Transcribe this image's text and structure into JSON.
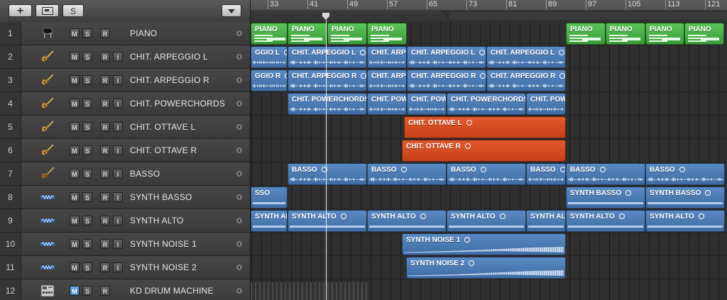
{
  "toolbar": {
    "add_label": "+",
    "solo_label": "S"
  },
  "ruler": {
    "bars": [
      "33",
      "41",
      "49",
      "57",
      "65",
      "73",
      "81",
      "89",
      "97",
      "105",
      "113",
      "121"
    ]
  },
  "tracks": [
    {
      "num": "1",
      "name": "PIANO",
      "icon": "grand-piano-icon",
      "msri": [
        "M",
        "S",
        "R"
      ]
    },
    {
      "num": "2",
      "name": "CHIT. ARPEGGIO L",
      "icon": "electric-guitar-icon",
      "msri": [
        "M",
        "S",
        "R",
        "I"
      ]
    },
    {
      "num": "3",
      "name": "CHIT. ARPEGGIO R",
      "icon": "electric-guitar-icon",
      "msri": [
        "M",
        "S",
        "R",
        "I"
      ]
    },
    {
      "num": "4",
      "name": "CHIT. POWERCHORDS",
      "icon": "electric-guitar-icon",
      "msri": [
        "M",
        "S",
        "R",
        "I"
      ]
    },
    {
      "num": "5",
      "name": "CHIT. OTTAVE L",
      "icon": "electric-guitar-icon",
      "msri": [
        "M",
        "S",
        "R",
        "I"
      ]
    },
    {
      "num": "6",
      "name": "CHIT. OTTAVE R",
      "icon": "electric-guitar-icon",
      "msri": [
        "M",
        "S",
        "R",
        "I"
      ]
    },
    {
      "num": "7",
      "name": "BASSO",
      "icon": "bass-guitar-icon",
      "msri": [
        "M",
        "S",
        "R",
        "I"
      ]
    },
    {
      "num": "8",
      "name": "SYNTH BASSO",
      "icon": "waveform-icon",
      "msri": [
        "M",
        "S",
        "R",
        "I"
      ]
    },
    {
      "num": "9",
      "name": "SYNTH ALTO",
      "icon": "waveform-icon",
      "msri": [
        "M",
        "S",
        "R",
        "I"
      ]
    },
    {
      "num": "10",
      "name": "SYNTH NOISE 1",
      "icon": "waveform-icon",
      "msri": [
        "M",
        "S",
        "R",
        "I"
      ]
    },
    {
      "num": "11",
      "name": "SYNTH NOISE 2",
      "icon": "waveform-icon",
      "msri": [
        "M",
        "S",
        "R",
        "I"
      ]
    },
    {
      "num": "12",
      "name": "KD DRUM MACHINE",
      "icon": "drum-machine-icon",
      "msri": [
        "M",
        "S",
        "R"
      ]
    }
  ],
  "regions": [
    {
      "track": 1,
      "start": 0,
      "end": 52,
      "label": "PIANO",
      "kind": "green"
    },
    {
      "track": 1,
      "start": 52,
      "end": 108,
      "label": "PIANO",
      "kind": "green"
    },
    {
      "track": 1,
      "start": 108,
      "end": 164,
      "label": "PIANO",
      "kind": "green"
    },
    {
      "track": 1,
      "start": 164,
      "end": 220,
      "label": "PIANO",
      "kind": "green"
    },
    {
      "track": 1,
      "start": 444,
      "end": 500,
      "label": "PIANO",
      "kind": "green"
    },
    {
      "track": 1,
      "start": 500,
      "end": 556,
      "label": "PIANO",
      "kind": "green"
    },
    {
      "track": 1,
      "start": 556,
      "end": 611,
      "label": "PIANO",
      "kind": "green"
    },
    {
      "track": 1,
      "start": 611,
      "end": 667,
      "label": "PIANO",
      "kind": "green"
    },
    {
      "track": 2,
      "start": 0,
      "end": 52,
      "label": "GGIO L",
      "kind": "audio",
      "loop": true
    },
    {
      "track": 2,
      "start": 52,
      "end": 164,
      "label": "CHIT. ARPEGGIO L",
      "kind": "audio",
      "loop": true
    },
    {
      "track": 2,
      "start": 164,
      "end": 220,
      "label": "CHIT. ARPEGGIO L",
      "kind": "audio",
      "loop": true
    },
    {
      "track": 2,
      "start": 220,
      "end": 332,
      "label": "CHIT. ARPEGGIO L",
      "kind": "audio",
      "loop": true
    },
    {
      "track": 2,
      "start": 332,
      "end": 444,
      "label": "CHIT. ARPEGGIO L",
      "kind": "audio",
      "loop": true
    },
    {
      "track": 3,
      "start": 0,
      "end": 52,
      "label": "GGIO R",
      "kind": "audio",
      "loop": true
    },
    {
      "track": 3,
      "start": 52,
      "end": 164,
      "label": "CHIT. ARPEGGIO R",
      "kind": "audio",
      "loop": true
    },
    {
      "track": 3,
      "start": 164,
      "end": 220,
      "label": "CHIT. ARPEGGIO R",
      "kind": "audio",
      "loop": true
    },
    {
      "track": 3,
      "start": 220,
      "end": 332,
      "label": "CHIT. ARPEGGIO R",
      "kind": "audio",
      "loop": true
    },
    {
      "track": 3,
      "start": 332,
      "end": 444,
      "label": "CHIT. ARPEGGIO R",
      "kind": "audio",
      "loop": true
    },
    {
      "track": 4,
      "start": 52,
      "end": 164,
      "label": "CHIT. POWERCHORDS",
      "kind": "audio"
    },
    {
      "track": 4,
      "start": 164,
      "end": 220,
      "label": "CHIT. POWERCHORDS",
      "kind": "audio"
    },
    {
      "track": 4,
      "start": 220,
      "end": 276,
      "label": "CHIT. POWERCHORDS",
      "kind": "audio"
    },
    {
      "track": 4,
      "start": 276,
      "end": 388,
      "label": "CHIT. POWERCHORDS",
      "kind": "audio"
    },
    {
      "track": 4,
      "start": 388,
      "end": 444,
      "label": "CHIT. POWERCHORDS",
      "kind": "audio"
    },
    {
      "track": 5,
      "start": 216,
      "end": 444,
      "label": "CHIT. OTTAVE L",
      "kind": "orange",
      "loop": true
    },
    {
      "track": 6,
      "start": 213,
      "end": 444,
      "label": "CHIT. OTTAVE R",
      "kind": "orange",
      "loop": true
    },
    {
      "track": 7,
      "start": 52,
      "end": 164,
      "label": "BASSO",
      "kind": "audio",
      "loop": true
    },
    {
      "track": 7,
      "start": 164,
      "end": 276,
      "label": "BASSO",
      "kind": "audio",
      "loop": true
    },
    {
      "track": 7,
      "start": 276,
      "end": 388,
      "label": "BASSO",
      "kind": "audio",
      "loop": true
    },
    {
      "track": 7,
      "start": 388,
      "end": 444,
      "label": "BASSO",
      "kind": "audio",
      "loop": true
    },
    {
      "track": 7,
      "start": 444,
      "end": 556,
      "label": "BASSO",
      "kind": "audio",
      "loop": true
    },
    {
      "track": 7,
      "start": 556,
      "end": 668,
      "label": "BASSO",
      "kind": "audio",
      "loop": true
    },
    {
      "track": 8,
      "start": 0,
      "end": 52,
      "label": "SSO",
      "kind": "audio",
      "thin": true
    },
    {
      "track": 8,
      "start": 444,
      "end": 556,
      "label": "SYNTH BASSO",
      "kind": "audio",
      "loop": true,
      "thin": true
    },
    {
      "track": 8,
      "start": 556,
      "end": 668,
      "label": "SYNTH BASSO",
      "kind": "audio",
      "loop": true,
      "thin": true
    },
    {
      "track": 9,
      "start": 0,
      "end": 52,
      "label": "SYNTH ALT",
      "kind": "audio",
      "thin": true
    },
    {
      "track": 9,
      "start": 52,
      "end": 164,
      "label": "SYNTH ALTO",
      "kind": "audio",
      "loop": true,
      "thin": true
    },
    {
      "track": 9,
      "start": 164,
      "end": 276,
      "label": "SYNTH ALTO",
      "kind": "audio",
      "loop": true,
      "thin": true
    },
    {
      "track": 9,
      "start": 276,
      "end": 388,
      "label": "SYNTH ALTO",
      "kind": "audio",
      "loop": true,
      "thin": true
    },
    {
      "track": 9,
      "start": 388,
      "end": 444,
      "label": "SYNTH ALTO",
      "kind": "audio",
      "loop": true,
      "thin": true
    },
    {
      "track": 9,
      "start": 444,
      "end": 556,
      "label": "SYNTH ALTO",
      "kind": "audio",
      "loop": true,
      "thin": true
    },
    {
      "track": 9,
      "start": 556,
      "end": 668,
      "label": "SYNTH ALTO",
      "kind": "audio",
      "loop": true,
      "thin": true
    },
    {
      "track": 10,
      "start": 213,
      "end": 444,
      "label": "SYNTH NOISE 1",
      "kind": "audio",
      "loop": true,
      "swell": true
    },
    {
      "track": 11,
      "start": 219,
      "end": 444,
      "label": "SYNTH NOISE 2",
      "kind": "audio",
      "loop": true,
      "swell": true
    }
  ],
  "colors": {
    "audio_region": "#4a7bb7",
    "orange_region": "#d94c22",
    "midi_region": "#46b044",
    "active_mute": "#4f8fd2"
  }
}
